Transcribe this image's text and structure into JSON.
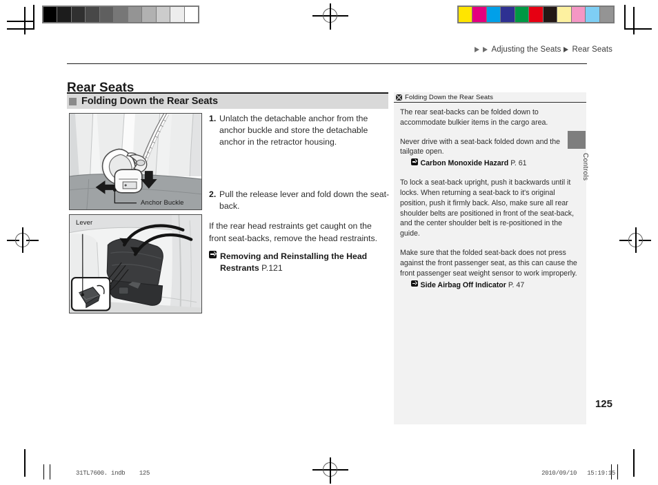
{
  "breadcrumb": {
    "items": [
      "Adjusting the Seats",
      "Rear Seats"
    ]
  },
  "page_title": "Rear Seats",
  "section": {
    "label": "Folding Down the Rear Seats"
  },
  "figures": [
    {
      "name": "rear-seat-anchor-buckle",
      "caption": "Anchor Buckle"
    },
    {
      "name": "cargo-area-release-lever",
      "caption": "Lever"
    }
  ],
  "steps": [
    {
      "num": "1.",
      "text": "Unlatch the detachable anchor from the anchor buckle and store the detachable anchor in the retractor housing."
    },
    {
      "num": "2.",
      "text": "Pull the release lever and fold down the seat-back."
    }
  ],
  "note_paragraph": "If the rear head restraints get caught on the front seat-backs, remove the head restraints.",
  "main_xref": {
    "title": "Removing and Reinstalling the Head Restrants",
    "page": "P.121"
  },
  "info_panel": {
    "header": "Folding Down the Rear Seats",
    "paragraphs": [
      "The rear seat-backs can be folded down to accommodate bulkier items in the cargo area.",
      "Never drive with a seat-back folded down and the tailgate open.",
      "To lock a seat-back upright, push it backwards until it locks. When returning a seat-back to it's original position, push it firmly back. Also, make sure all rear shoulder belts are positioned in front of the seat-back, and the center shoulder belt is re-positioned in the guide.",
      "Make sure that the folded seat-back does not press against the front passenger seat, as this can cause the front passenger seat weight sensor to work improperly."
    ],
    "xrefs": [
      {
        "title": "Carbon Monoxide Hazard",
        "page": "P. 61"
      },
      {
        "title": "Side Airbag Off Indicator",
        "page": "P. 47"
      }
    ]
  },
  "side_tab": {
    "label": "Controls"
  },
  "folio": "125",
  "print_footer": {
    "file": "31TL7600. indb",
    "page": "125",
    "date": "2010/09/10",
    "time": "15:19:15"
  },
  "calibration": {
    "grayscale": [
      "#000000",
      "#1c1c1c",
      "#303030",
      "#484848",
      "#5f5f5f",
      "#777777",
      "#949494",
      "#b1b1b1",
      "#cccccc",
      "#ededed",
      "#ffffff"
    ],
    "colors": [
      "#ffe500",
      "#e5007e",
      "#00a0e9",
      "#2e3192",
      "#009944",
      "#e60012",
      "#231815",
      "#fdf1a0",
      "#f497c4",
      "#7ecef4",
      "#949494"
    ]
  }
}
